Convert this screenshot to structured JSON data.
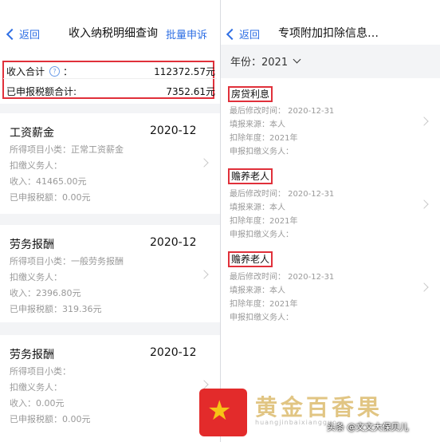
{
  "left": {
    "nav": {
      "back": "返回",
      "title": "收入纳税明细查询",
      "action": "批量申诉"
    },
    "summary": {
      "income_label": "收入合计",
      "income_colon": "：",
      "income_value": "112372.57元",
      "tax_label": "已申报税额合计:",
      "tax_value": "7352.61元"
    },
    "records": [
      {
        "type": "工资薪金",
        "date": "2020-12",
        "subtype": "所得项目小类：正常工资薪金",
        "agent": "扣缴义务人：",
        "income": "收入：41465.00元",
        "tax": "已申报税额：0.00元"
      },
      {
        "type": "劳务报酬",
        "date": "2020-12",
        "subtype": "所得项目小类：一般劳务报酬",
        "agent": "扣缴义务人：",
        "income": "收入：2396.80元",
        "tax": "已申报税额：319.36元"
      },
      {
        "type": "劳务报酬",
        "date": "2020-12",
        "subtype": "所得项目小类：",
        "agent": "扣缴义务人：",
        "income": "收入：0.00元",
        "tax": "已申报税额：0.00元"
      }
    ]
  },
  "right": {
    "nav": {
      "back": "返回",
      "title": "专项附加扣除信息…"
    },
    "year_label": "年份：2021",
    "items": [
      {
        "title": "房贷利息",
        "modified": "最后修改时间：  2020-12-31",
        "source": "填报来源：本人",
        "year": "扣除年度：2021年",
        "agent": "申报扣缴义务人："
      },
      {
        "title": "赡养老人",
        "modified": "最后修改时间：  2020-12-31",
        "source": "填报来源：本人",
        "year": "扣除年度：2021年",
        "agent": "申报扣缴义务人："
      },
      {
        "title": "赡养老人",
        "modified": "最后修改时间：  2020-12-31",
        "source": "填报来源：本人",
        "year": "扣除年度：2021年",
        "agent": "申报扣缴义务人："
      }
    ]
  },
  "watermark": {
    "brand": "黄金百香果",
    "url": "huangjinbaixiangguo",
    "author": "头条 @文文大保贝儿"
  },
  "colors": {
    "accent": "#2f6fe4",
    "highlight_border": "#e0303a"
  }
}
